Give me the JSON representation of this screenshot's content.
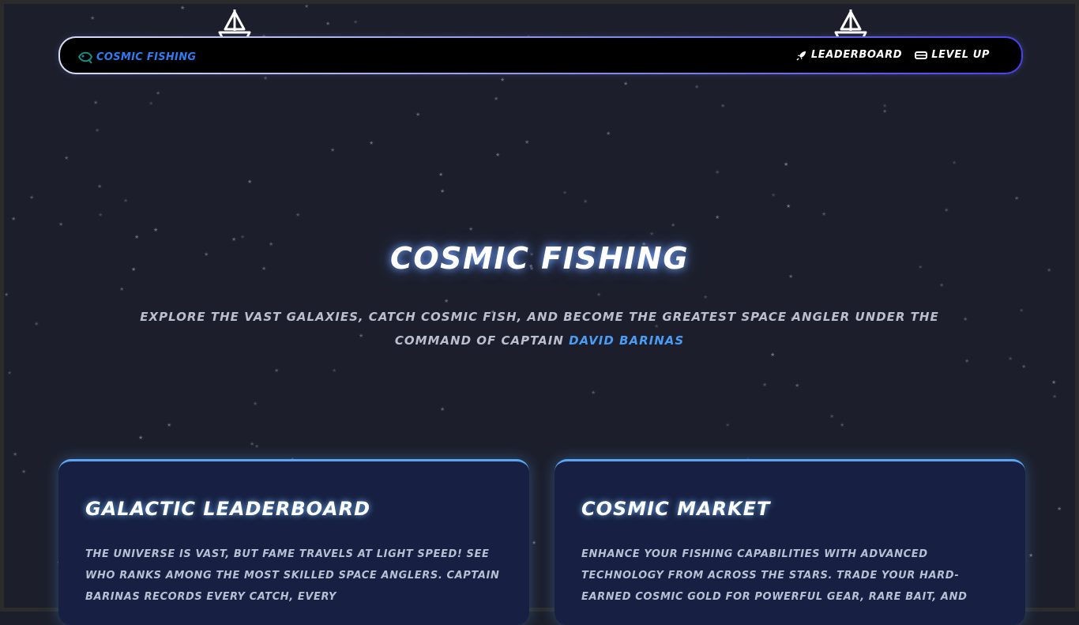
{
  "nav": {
    "brand": "COSMIC FISHING",
    "links": [
      {
        "label": "LEADERBOARD",
        "icon": "rocket-icon"
      },
      {
        "label": "LEVEL UP",
        "icon": "card-icon"
      }
    ]
  },
  "hero": {
    "title": "COSMIC FISHING",
    "subtitle_lead": "EXPLORE THE VAST GALAXIES, CATCH COSMIC FISH, AND BECOME THE GREATEST SPACE ANGLER UNDER THE COMMAND OF CAPTAIN",
    "captain": "DAVID BARINAS"
  },
  "cards": [
    {
      "title": "GALACTIC LEADERBOARD",
      "text": "THE UNIVERSE IS VAST, BUT FAME TRAVELS AT LIGHT SPEED! SEE WHO RANKS AMONG THE MOST SKILLED SPACE ANGLERS. CAPTAIN BARINAS RECORDS EVERY CATCH, EVERY"
    },
    {
      "title": "COSMIC MARKET",
      "text": "ENHANCE YOUR FISHING CAPABILITIES WITH ADVANCED TECHNOLOGY FROM ACROSS THE STARS. TRADE YOUR HARD-EARNED COSMIC GOLD FOR POWERFUL GEAR, RARE BAIT, AND"
    }
  ],
  "colors": {
    "background": "#1c1f2b",
    "brand": "#2f7cf2",
    "captain": "#4a9cf5",
    "card": "#172042",
    "card_border": "#5aa6f5"
  }
}
